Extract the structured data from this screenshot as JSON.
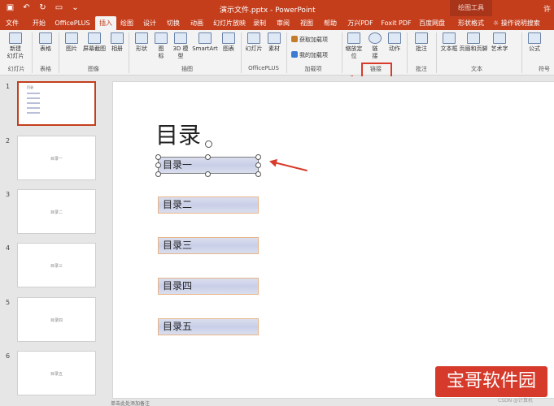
{
  "titlebar": {
    "title": "演示文件.pptx - PowerPoint",
    "context_tool": "绘图工具",
    "user": "许"
  },
  "tabs": [
    "文件",
    "开始",
    "OfficePLUS",
    "插入",
    "绘图",
    "设计",
    "切换",
    "动画",
    "幻灯片放映",
    "录制",
    "审阅",
    "视图",
    "帮助",
    "万兴PDF",
    "Foxit PDF",
    "百度网盘",
    "形状格式"
  ],
  "active_tab": "插入",
  "tell_me": "操作说明搜索",
  "ribbon": {
    "new_slide": "新建\n幻灯片",
    "table": "表格",
    "picture": "图片",
    "screenshot": "屏幕截图",
    "album": "相册",
    "shapes": "形状",
    "icons": "图\n标",
    "models3d": "3D 模\n型",
    "smartart": "SmartArt",
    "chart": "图表",
    "officeplus_slide": "幻灯片",
    "material": "素材",
    "get_addins": "获取加载项",
    "my_addins": "我的加载项",
    "zoom": "缩放定\n位",
    "link": "链\n接",
    "action": "动作",
    "comment": "批注",
    "textbox": "文本框",
    "header_footer": "页眉和页脚",
    "wordart": "艺术字",
    "equation": "公式",
    "groups": {
      "slides": "幻灯片",
      "tables": "表格",
      "images": "图像",
      "illustrations": "插图",
      "officeplus": "OfficePLUS",
      "addins": "加载项",
      "links": "链接",
      "comments": "批注",
      "text": "文本",
      "symbols": "符号"
    }
  },
  "thumbnails": [
    {
      "num": "1",
      "label": "目录"
    },
    {
      "num": "2",
      "label": "目录一"
    },
    {
      "num": "3",
      "label": "目录二"
    },
    {
      "num": "4",
      "label": "目录三"
    },
    {
      "num": "5",
      "label": "目录四"
    },
    {
      "num": "6",
      "label": "目录五"
    }
  ],
  "slide": {
    "title": "目录",
    "items": [
      "目录一",
      "目录二",
      "目录三",
      "目录四",
      "目录五"
    ]
  },
  "status": "单击此处添加备注",
  "watermark": {
    "text": "宝哥软件园",
    "sub": "CSDN @计算机"
  }
}
